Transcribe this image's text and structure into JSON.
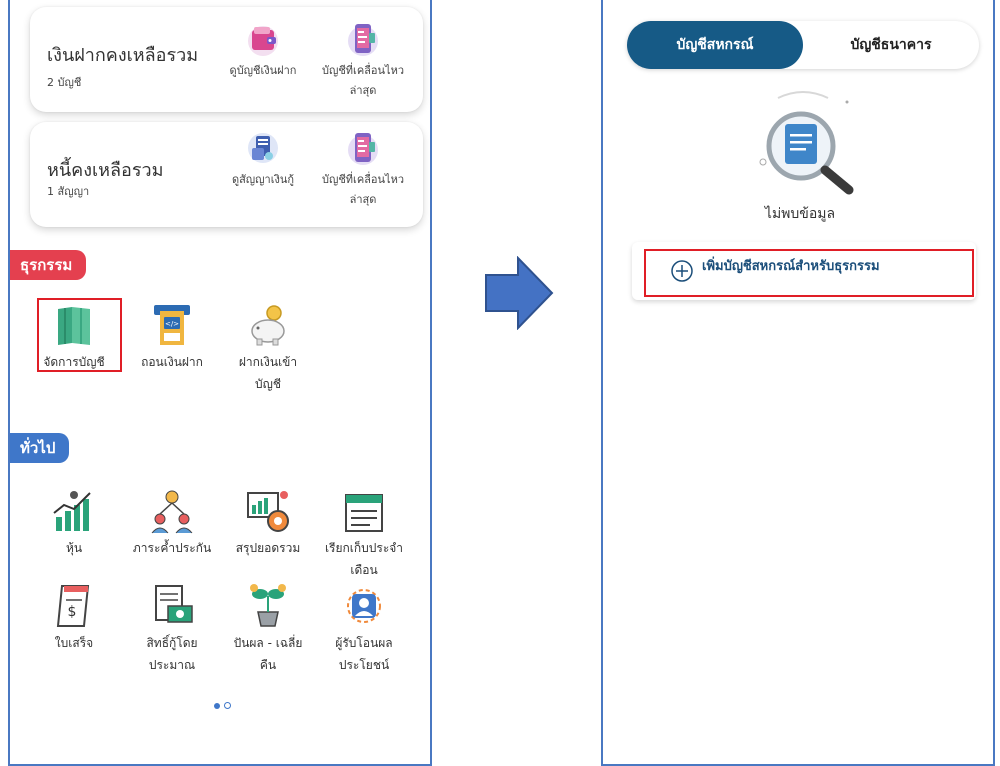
{
  "left_screen": {
    "card_deposit": {
      "title": "เงินฝากคงเหลือรวม",
      "subtitle": "2 บัญชี",
      "actions": [
        {
          "icon": "wallet-icon",
          "label_1": "ดูบัญชีเงินฝาก",
          "label_2": ""
        },
        {
          "icon": "phone-transactions-icon",
          "label_1": "บัญชีที่เคลื่อนไหว",
          "label_2": "ล่าสุด"
        }
      ]
    },
    "card_loan": {
      "title": "หนี้คงเหลือรวม",
      "subtitle": "1 สัญญา",
      "actions": [
        {
          "icon": "contract-icon",
          "label_1": "ดูสัญญาเงินกู้",
          "label_2": ""
        },
        {
          "icon": "phone-transactions-icon",
          "label_1": "บัญชีที่เคลื่อนไหว",
          "label_2": "ล่าสุด"
        }
      ]
    },
    "section_transactions": {
      "label": "ธุรกรรม",
      "color": "#e4404f",
      "items": [
        {
          "icon": "account-book-icon",
          "label_1": "จัดการบัญชี",
          "label_2": ""
        },
        {
          "icon": "atm-withdraw-icon",
          "label_1": "ถอนเงินฝาก",
          "label_2": ""
        },
        {
          "icon": "piggy-bank-icon",
          "label_1": "ฝากเงินเข้า",
          "label_2": "บัญชี"
        }
      ]
    },
    "section_general": {
      "label": "ทั่วไป",
      "color": "#3f77c9",
      "items": [
        {
          "icon": "stock-chart-icon",
          "label_1": "หุ้น",
          "label_2": ""
        },
        {
          "icon": "guarantee-people-icon",
          "label_1": "ภาระค้ำประกัน",
          "label_2": ""
        },
        {
          "icon": "summary-report-icon",
          "label_1": "สรุปยอดรวม",
          "label_2": ""
        },
        {
          "icon": "calendar-bill-icon",
          "label_1": "เรียกเก็บประจำ",
          "label_2": "เดือน"
        },
        {
          "icon": "receipt-icon",
          "label_1": "ใบเสร็จ",
          "label_2": ""
        },
        {
          "icon": "loan-estimate-icon",
          "label_1": "สิทธิ์กู้โดย",
          "label_2": "ประมาณ"
        },
        {
          "icon": "dividend-plant-icon",
          "label_1": "ปันผล - เฉลี่ย",
          "label_2": "คืน"
        },
        {
          "icon": "beneficiary-icon",
          "label_1": "ผู้รับโอนผล",
          "label_2": "ประโยชน์"
        }
      ]
    },
    "pagination": {
      "active_color": "#3f77c9"
    }
  },
  "arrow": {
    "color": "#4472c4",
    "icon": "right-arrow-icon"
  },
  "right_screen": {
    "tabs": [
      {
        "label": "บัญชีสหกรณ์",
        "active": true
      },
      {
        "label": "บัญชีธนาคาร",
        "active": false
      }
    ],
    "empty_state": {
      "icon": "magnifier-document-icon",
      "label": "ไม่พบข้อมูล"
    },
    "add_button": {
      "icon": "plus-circle-icon",
      "label": "เพิ่มบัญชีสหกรณ์สำหรับธุรกรรม"
    },
    "accent_color": "#165a86",
    "highlight_color": "#e01e26"
  }
}
